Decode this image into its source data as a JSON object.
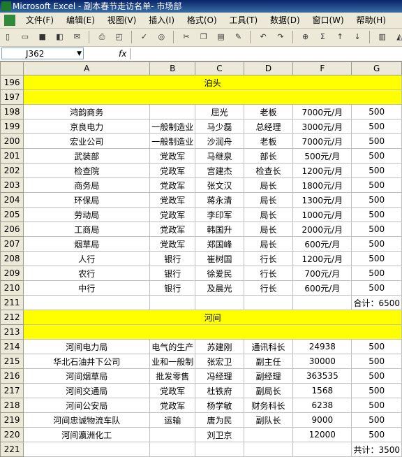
{
  "window": {
    "title": "Microsoft Excel - 副本春节走访名单- 市场部"
  },
  "menu": [
    "文件(F)",
    "编辑(E)",
    "视图(V)",
    "插入(I)",
    "格式(O)",
    "工具(T)",
    "数据(D)",
    "窗口(W)",
    "帮助(H)"
  ],
  "formula_bar": {
    "name_box": "J362",
    "fx": "fx",
    "content": ""
  },
  "columns": [
    "A",
    "B",
    "C",
    "D",
    "F",
    "G"
  ],
  "rows": [
    {
      "n": "196",
      "banner": "泊头"
    },
    {
      "n": "197",
      "banner": ""
    },
    {
      "n": "198",
      "cells": [
        "鸿韵商务",
        "",
        "屈光",
        "老板",
        "7000元/月",
        "500"
      ]
    },
    {
      "n": "199",
      "cells": [
        "京良电力",
        "一般制造业",
        "马少磊",
        "总经理",
        "3000元/月",
        "500"
      ]
    },
    {
      "n": "200",
      "cells": [
        "宏业公司",
        "一般制造业",
        "沙润舟",
        "老板",
        "7000元/月",
        "500"
      ]
    },
    {
      "n": "201",
      "cells": [
        "武装部",
        "党政军",
        "马继泉",
        "部长",
        "500元/月",
        "500"
      ]
    },
    {
      "n": "202",
      "cells": [
        "检查院",
        "党政军",
        "宫建杰",
        "检查长",
        "1200元/月",
        "500"
      ]
    },
    {
      "n": "203",
      "cells": [
        "商务局",
        "党政军",
        "张文汉",
        "局长",
        "1800元/月",
        "500"
      ]
    },
    {
      "n": "204",
      "cells": [
        "环保局",
        "党政军",
        "蒋永清",
        "局长",
        "1300元/月",
        "500"
      ]
    },
    {
      "n": "205",
      "cells": [
        "劳动局",
        "党政军",
        "李印军",
        "局长",
        "1000元/月",
        "500"
      ]
    },
    {
      "n": "206",
      "cells": [
        "工商局",
        "党政军",
        "韩国升",
        "局长",
        "2000元/月",
        "500"
      ]
    },
    {
      "n": "207",
      "cells": [
        "烟草局",
        "党政军",
        "郑国峰",
        "局长",
        "600元/月",
        "500"
      ]
    },
    {
      "n": "208",
      "cells": [
        "人行",
        "银行",
        "崔树国",
        "行长",
        "1200元/月",
        "500"
      ]
    },
    {
      "n": "209",
      "cells": [
        "农行",
        "银行",
        "徐爱民",
        "行长",
        "700元/月",
        "500"
      ]
    },
    {
      "n": "210",
      "cells": [
        "中行",
        "银行",
        "及晨光",
        "行长",
        "600元/月",
        "500"
      ]
    },
    {
      "n": "211",
      "total": "合计：6500"
    },
    {
      "n": "212",
      "banner": "河间"
    },
    {
      "n": "213",
      "banner": ""
    },
    {
      "n": "214",
      "cells": [
        "河间电力局",
        "电气的生产",
        "苏建刚",
        "通讯科长",
        "24938",
        "500"
      ]
    },
    {
      "n": "215",
      "cells": [
        "华北石油井下公司",
        "业和一般制",
        "张宏卫",
        "副主任",
        "30000",
        "500"
      ]
    },
    {
      "n": "216",
      "cells": [
        "河间烟草局",
        "批发零售",
        "冯经理",
        "副经理",
        "363535",
        "500"
      ]
    },
    {
      "n": "217",
      "cells": [
        "河间交通局",
        "党政军",
        "杜铁府",
        "副局长",
        "1568",
        "500"
      ]
    },
    {
      "n": "218",
      "cells": [
        "河间公安局",
        "党政军",
        "杨学敏",
        "财务科长",
        "6238",
        "500"
      ]
    },
    {
      "n": "219",
      "cells": [
        "河间忠诚物流车队",
        "运输",
        "唐为民",
        "副队长",
        "9000",
        "500"
      ]
    },
    {
      "n": "220",
      "cells": [
        "河间瀛洲化工",
        "",
        "刘卫京",
        "",
        "12000",
        "500"
      ]
    },
    {
      "n": "221",
      "total": "共计：3500"
    }
  ]
}
